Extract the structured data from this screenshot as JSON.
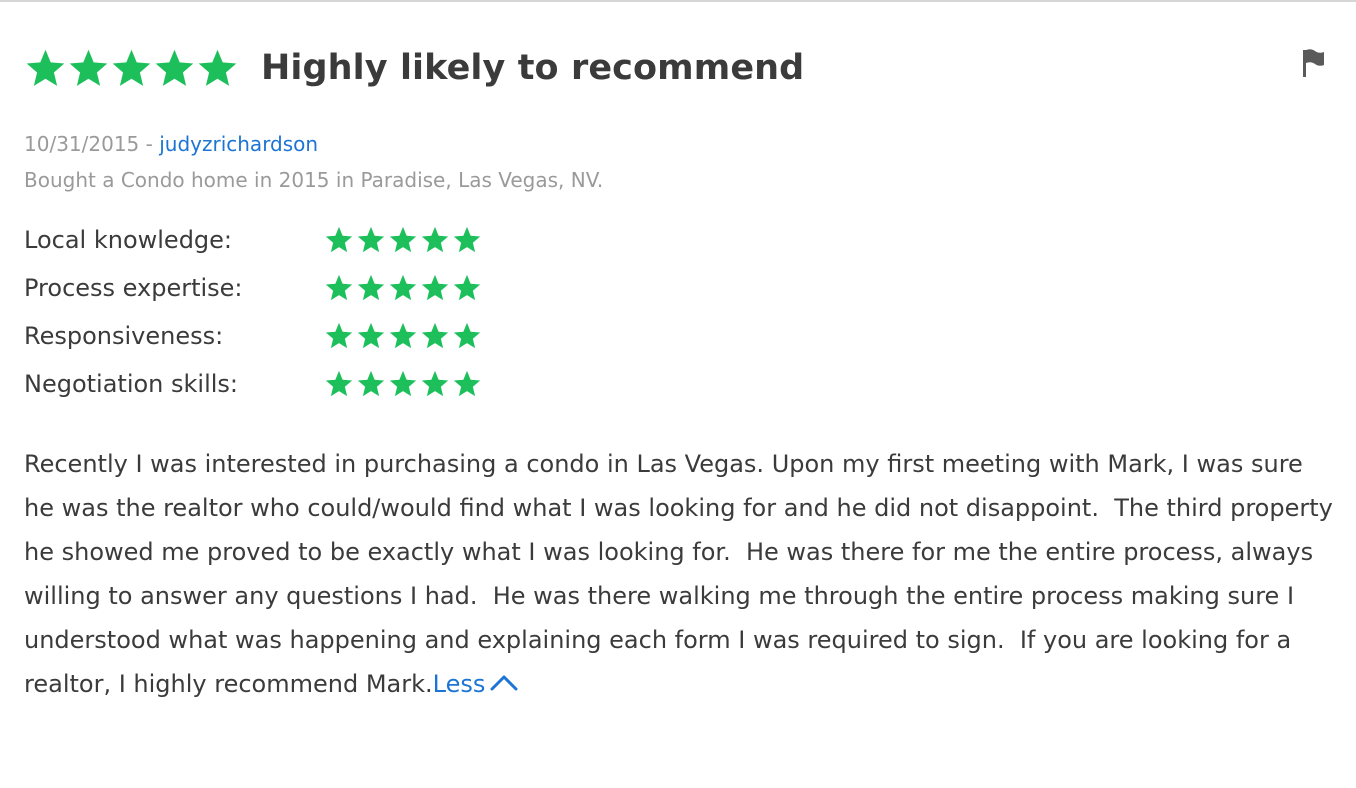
{
  "review": {
    "rating": 5,
    "rating_max": 5,
    "title": "Highly likely to recommend",
    "date": "10/31/2015",
    "separator": " - ",
    "username": "judyzrichardson",
    "transaction": "Bought a Condo home in 2015 in Paradise, Las Vegas, NV.",
    "sub_ratings": [
      {
        "label": "Local knowledge:",
        "stars": 5
      },
      {
        "label": "Process expertise:",
        "stars": 5
      },
      {
        "label": "Responsiveness:",
        "stars": 5
      },
      {
        "label": "Negotiation skills:",
        "stars": 5
      }
    ],
    "text": "Recently I was interested in purchasing a condo in Las Vegas. Upon my first meeting with Mark, I was sure he was the realtor who could/would find what I was looking for and he did not disappoint.  The third property he showed me proved to be exactly what I was looking for.  He was there for me the entire process, always willing to answer any questions I had.  He was there walking me through the entire process making sure I understood what was happening and explaining each form I was required to sign.  If you are looking for a realtor, I highly recommend Mark.",
    "less_label": "Less"
  },
  "icons": {
    "star": "star-icon",
    "flag": "flag-icon",
    "chevron": "chevron-up-icon"
  },
  "colors": {
    "star": "#1dbf5a",
    "link": "#1c74d4",
    "text": "#3b3b3b",
    "muted": "#9a9a9a",
    "flag": "#5a5a5a"
  }
}
